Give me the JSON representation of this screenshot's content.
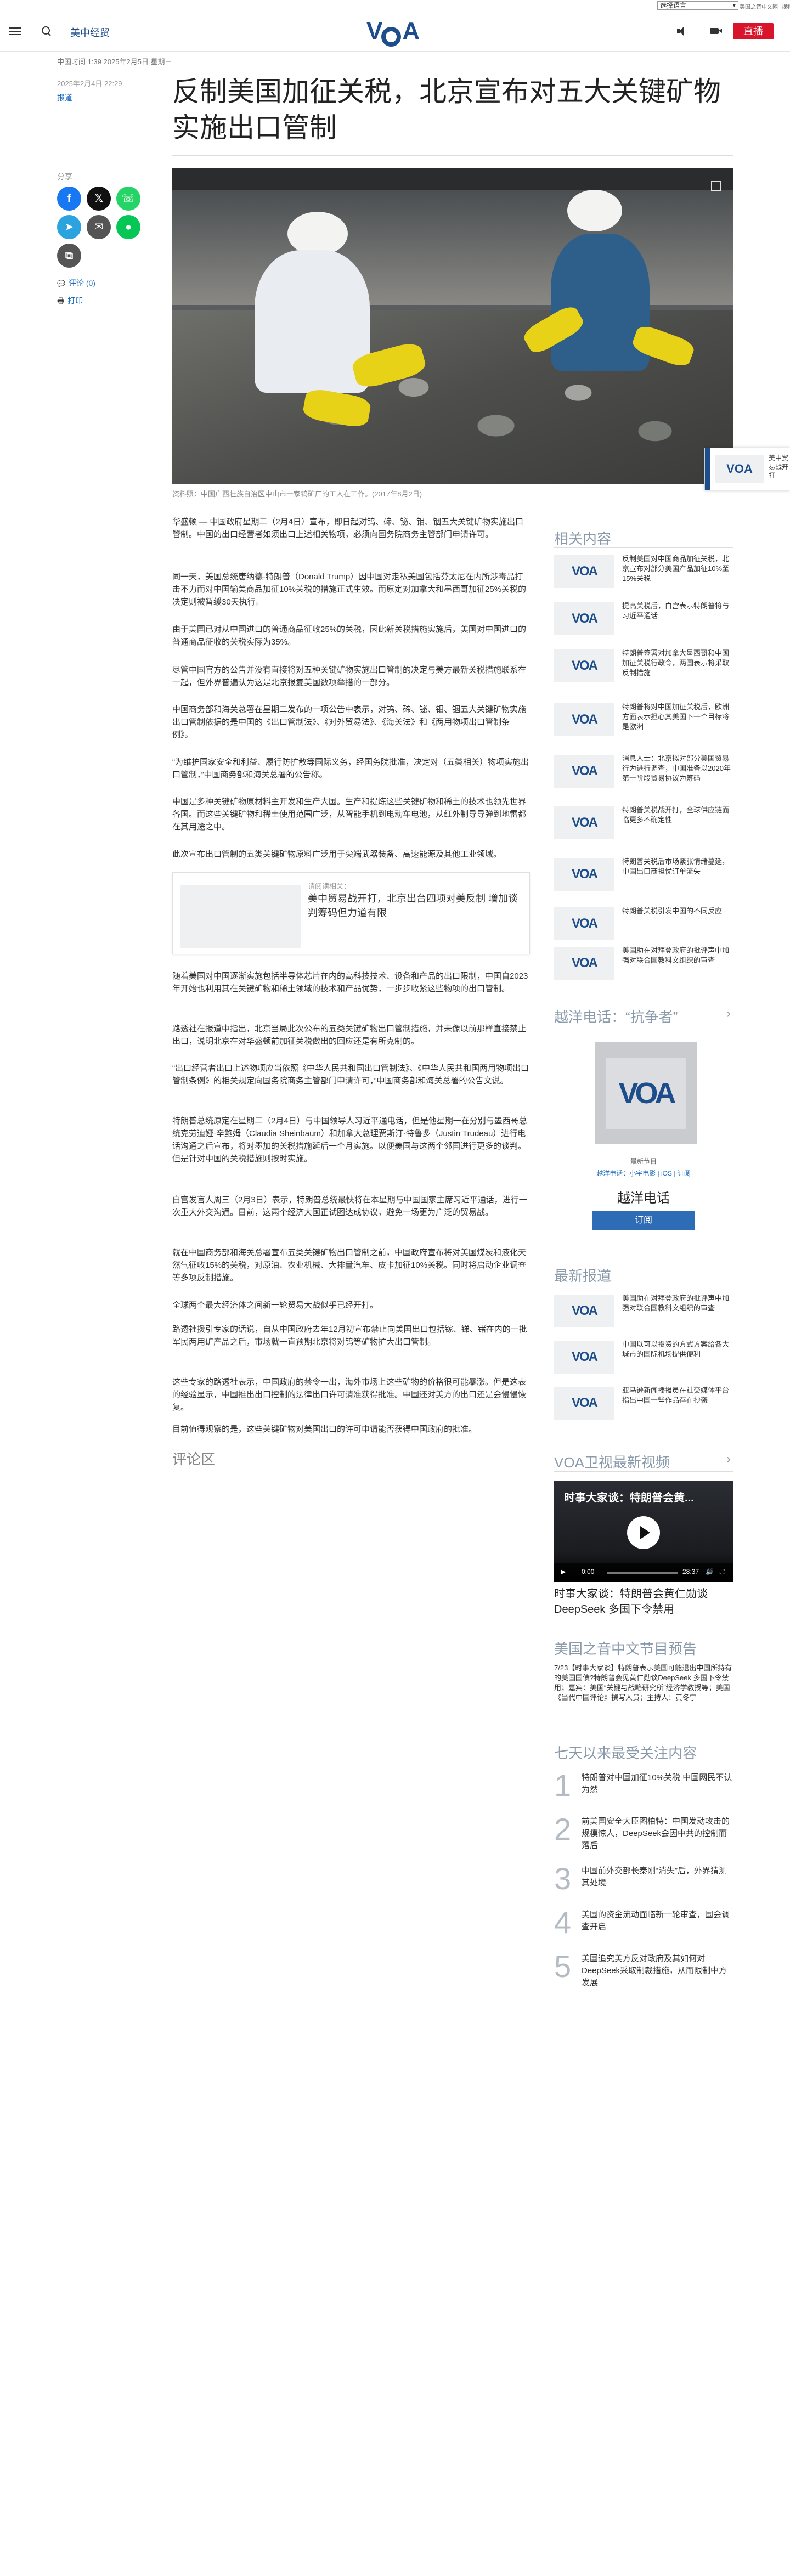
{
  "util": {
    "language_select": "选择语言",
    "links": [
      "美国之音中文网",
      "视频",
      "直播"
    ]
  },
  "header": {
    "section": "美中经贸",
    "logo": "VOA",
    "live_label": "直播"
  },
  "meta": {
    "line": "中国时间 1:39 2025年2月5日 星期三"
  },
  "article": {
    "pubdate": "2025年2月4日 22:29",
    "category": "报道",
    "headline": "反制美国加征关税，北京宣布对五大关键矿物实施出口管制",
    "caption": "资料照：中国广西壮族自治区中山市一家钨矿厂的工人在工作。(2017年8月2日)",
    "share_label": "分享",
    "comments_link": "评论 (0)",
    "print_link": "打印",
    "paragraphs": [
      "华盛顿 — 中国政府星期二（2月4日）宣布，即日起对钨、碲、铋、钼、铟五大关键矿物实施出口管制。中国的出口经营者如须出口上述相关物项，必须向国务院商务主管部门申请许可。",
      "同一天，美国总统唐纳德·特朗普（Donald Trump）因中国对走私美国包括芬太尼在内所涉毒品打击不力而对中国输美商品加征10%关税的措施正式生效。而原定对加拿大和墨西哥加征25%关税的决定则被暂缓30天执行。",
      "由于美国已对从中国进口的普通商品征收25%的关税，因此新关税措施实施后，美国对中国进口的普通商品征收的关税实际为35%。",
      "尽管中国官方的公告并没有直接将对五种关键矿物实施出口管制的决定与美方最新关税措施联系在一起，但外界普遍认为这是北京报复美国数项举措的一部分。",
      "中国商务部和海关总署在星期二发布的一项公告中表示，对钨、碲、铋、钼、铟五大关键矿物实施出口管制依据的是中国的《出口管制法》、《对外贸易法》、《海关法》和《两用物项出口管制条例》。",
      "“为维护国家安全和利益、履行防扩散等国际义务，经国务院批准，决定对（五类相关）物项实施出口管制，”中国商务部和海关总署的公告称。",
      "中国是多种关键矿物原材料主开发和生产大国。生产和提炼这些关键矿物和稀土的技术也领先世界各国。而这些关键矿物和稀土使用范围广泛，从智能手机到电动车电池，从红外制导导弹到地雷都在其用途之中。",
      "此次宣布出口管制的五类关键矿物原料广泛用于尖端武器装备、高速能源及其他工业领域。",
      "随着美国对中国逐渐实施包括半导体芯片在内的高科技技术、设备和产品的出口限制，中国自2023年开始也利用其在关键矿物和稀土领域的技术和产品优势，一步步收紧这些物项的出口管制。",
      "路透社在报道中指出，北京当局此次公布的五类关键矿物出口管制措施，并未像以前那样直接禁止出口，说明北京在对华盛顿前加征关税做出的回应还是有所克制的。",
      "“出口经营者出口上述物项应当依照《中华人民共和国出口管制法》、《中华人民共和国两用物项出口管制条例》的相关规定向国务院商务主管部门申请许可，”中国商务部和海关总署的公告文说。",
      "特朗普总统原定在星期二（2月4日）与中国领导人习近平通电话，但是他星期一在分别与墨西哥总统克劳迪娅·辛鲍姆（Claudia Sheinbaum）和加拿大总理贾斯汀·特鲁多（Justin Trudeau）进行电话沟通之后宣布，将对墨加的关税措施延后一个月实施。以便美国与这两个邻国进行更多的谈判。但是针对中国的关税措施则按时实施。",
      "白宫发言人周三（2月3日）表示，特朗普总统最快将在本星期与中国国家主席习近平通话，进行一次重大外交沟通。目前，这两个经济大国正试图达成协议，避免一场更为广泛的贸易战。",
      "就在中国商务部和海关总署宣布五类关键矿物出口管制之前，中国政府宣布将对美国煤炭和液化天然气征收15%的关税，对原油、农业机械、大排量汽车、皮卡加征10%关税。同时将启动企业调查等多项反制措施。",
      "全球两个最大经济体之间新一轮贸易大战似乎已经开打。",
      "路透社援引专家的话说，自从中国政府去年12月初宣布禁止向美国出口包括镓、锑、锗在内的一批军民两用矿产品之后，市场就一直预期北京将对钨等矿物扩大出口管制。",
      "这些专家的路透社表示，中国政府的禁令一出，海外市场上这些矿物的价格很可能暴涨。但是这表的经验显示，中国推出出口控制的法律出口许可请准获得批准。中国还对美方的出口还是会慢慢恢复。",
      "目前值得观察的是，这些关键矿物对美国出口的许可申请能否获得中国政府的批准。"
    ],
    "related_inline": {
      "label": "请阅读相关：",
      "title": "美中贸易战开打，北京出台四项对美反制 增加谈判筹码但力道有限"
    },
    "comments_title": "评论区"
  },
  "float_widget": {
    "text": "美中贸易战开打"
  },
  "sidebar": {
    "related_heading": "相关内容",
    "related": [
      "反制美国对中国商品加征关税，北京宣布对部分美国产品加征10%至15%关税",
      "提高关税后，白宫表示特朗普将与习近平通话",
      "特朗普签署对加拿大墨西哥和中国加征关税行政令，两国表示将采取反制措施",
      "特朗普将对中国加征关税后，欧洲方面表示担心其美国下一个目标将是欧洲",
      "消息人士：北京拟对部分美国贸易行为进行调查，中国准备以2020年第一阶段贸易协议为筹码",
      "特朗普关税战开打，全球供应链面临更多不确定性",
      "特朗普关税后市场紧张情绪蔓延，中国出口商担忧订单流失",
      "特朗普关税引发中国的不同反应"
    ],
    "podcast_heading": "越洋电话：“抗争者”",
    "podcast_cover": "VOA",
    "podcast_latest": "最新节目",
    "podcast_links": "越洋电话：小宇电影 | iOS | 订阅",
    "podcast_title": "越洋电话",
    "subscribe_label": "订阅",
    "latest_heading": "最新报道",
    "latest": [
      "美国助在对拜登政府的批评声中加强对联合国教科文组织的审查",
      "中国以可以投资的方式方案给各大城市的国际机场提供便利",
      "亚马逊新闻播报员在社交媒体平台指出中国一些作品存在抄袭"
    ],
    "video_heading": "VOA卫视最新视频",
    "video_title": "时事大家谈：特朗普会黄...",
    "video_time_left": "0:00",
    "video_time_right": "28:37",
    "video_progress": 0.0,
    "video_caption": "时事大家谈：特朗普会黄仁勋谈DeepSeek 多国下令禁用",
    "program_heading": "美国之音中文节目预告",
    "program_text": "7/23【时事大家谈】特朗普表示美国可能退出中国所持有的美国国债?特朗普会见黄仁勋谈DeepSeek 多国下令禁用；嘉宾：美国“关键与战略研究所”经济学教授等；美国《当代中国评论》撰写人员；主持人：黄冬宁",
    "top_heading": "七天以来最受关注内容",
    "top": [
      "特朗普对中国加征10%关税 中国网民不认为然",
      "前美国安全大臣图柏特：中国发动攻击的规模惊人，DeepSeek会因中共的控制而落后",
      "中国前外交部长秦刚“消失”后，外界猜测其处境",
      "美国的资金流动面临新一轮审查，国会调查开启",
      "美国追究美方反对政府及其如何对DeepSeek采取制裁措施，从而限制中方发展"
    ]
  }
}
